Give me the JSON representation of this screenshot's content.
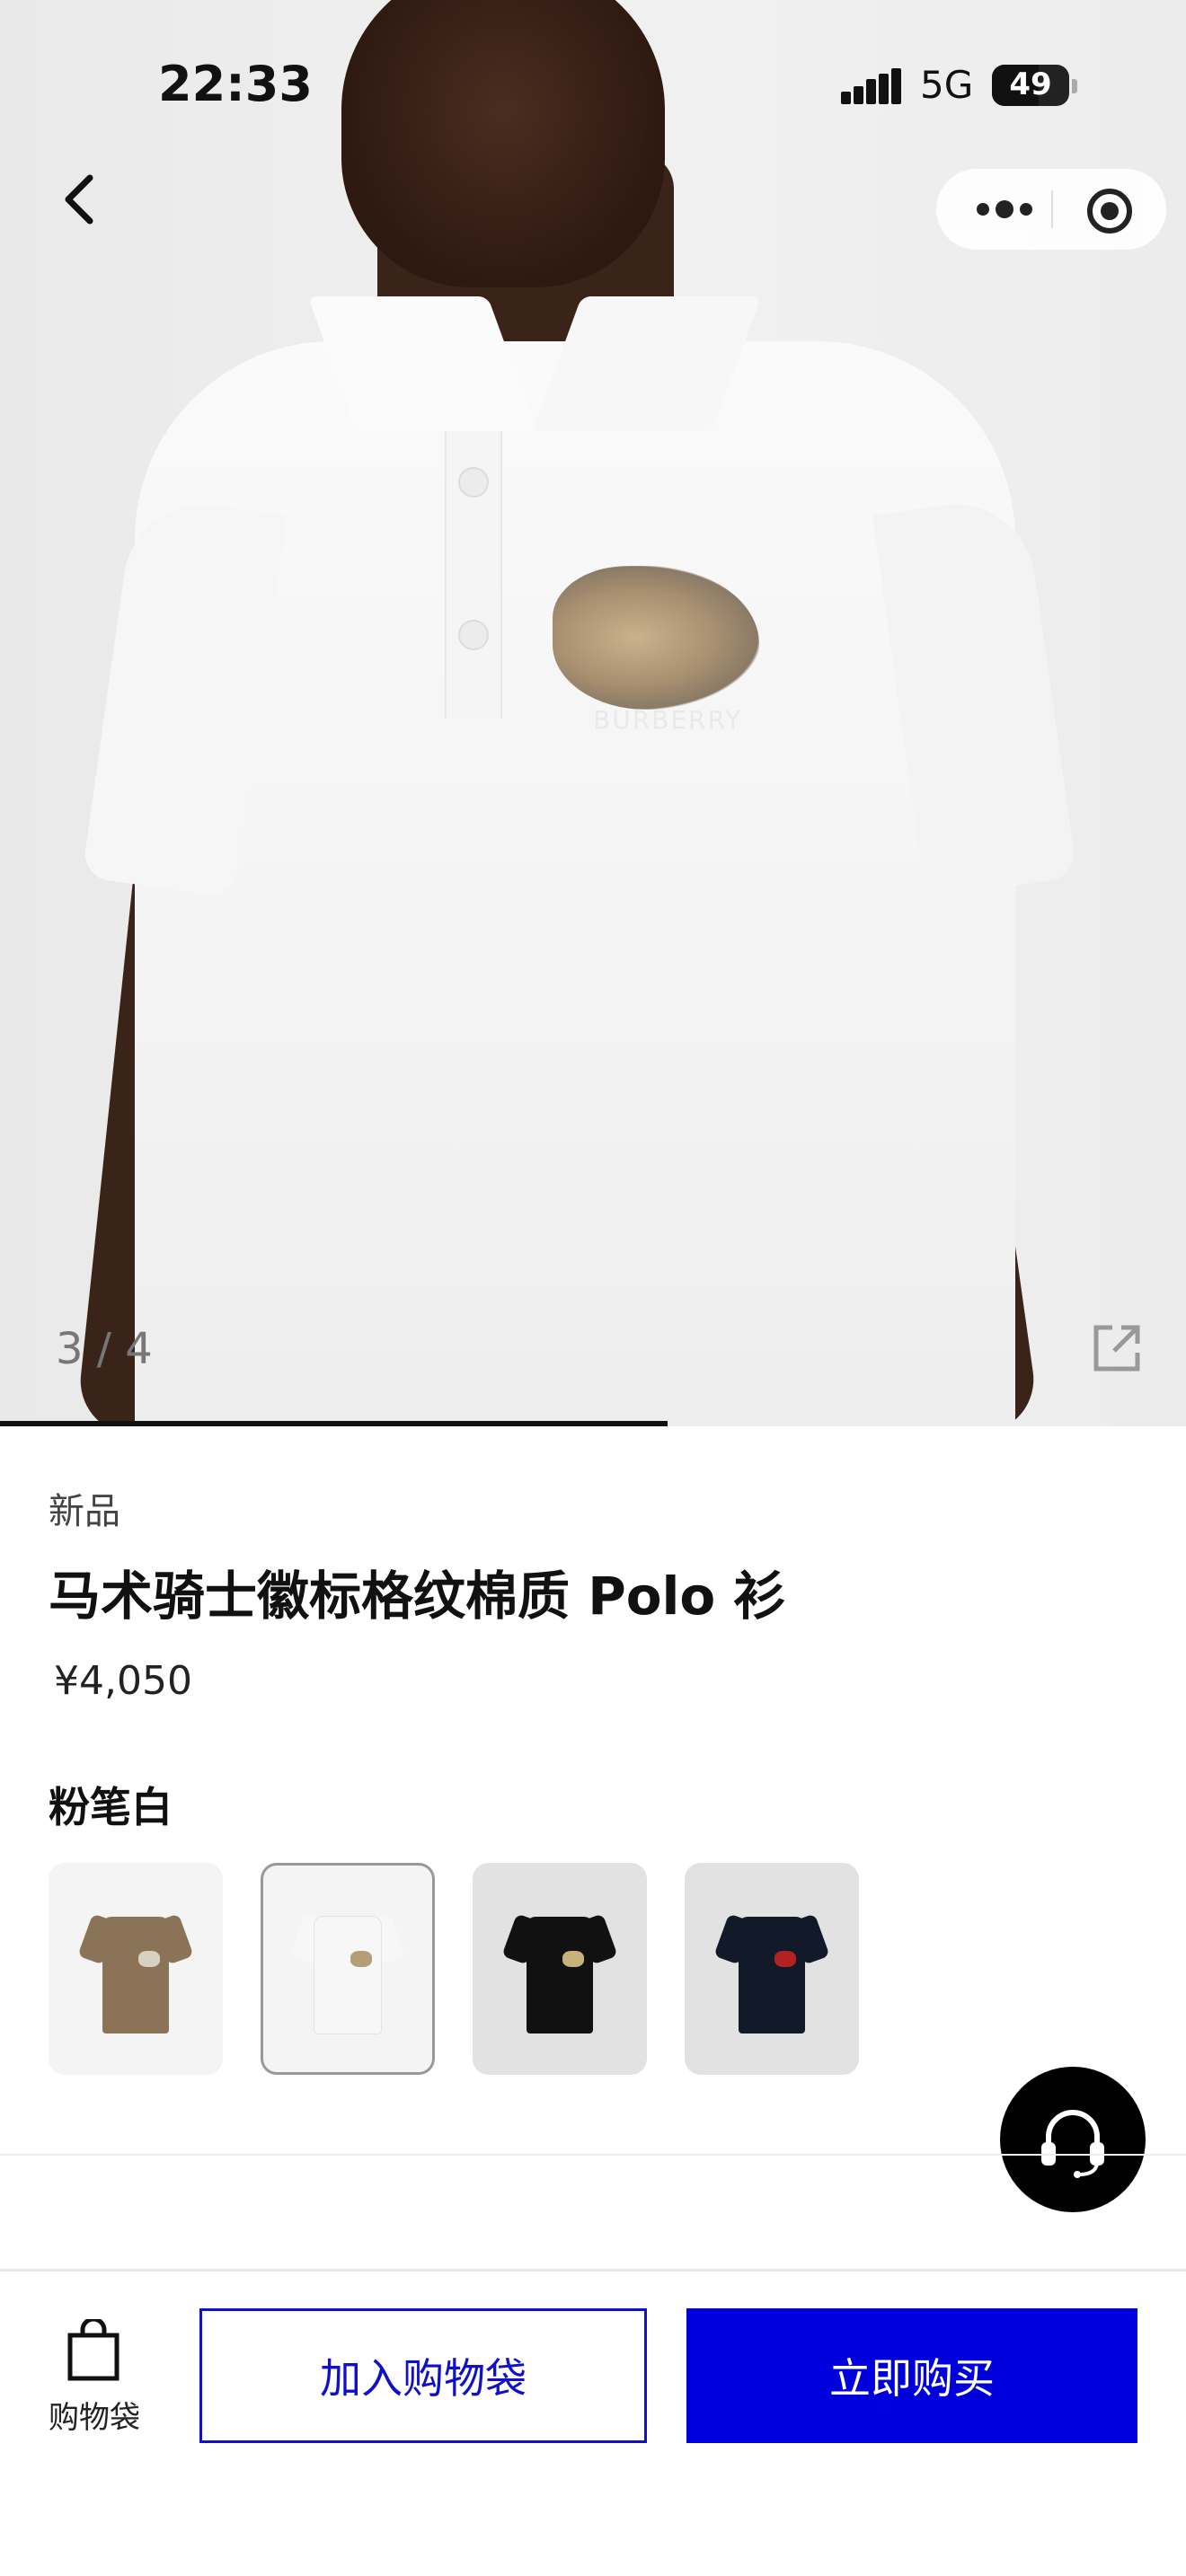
{
  "status_bar": {
    "time": "22:33",
    "network": "5G",
    "battery": "49"
  },
  "gallery": {
    "page_indicator": "3 / 4",
    "progress": 0.75,
    "emblem_text": "BURBERRY"
  },
  "product": {
    "tag": "新品",
    "title": "马术骑士徽标格纹棉质 Polo 衫",
    "price": "¥4,050",
    "color_name": "粉笔白",
    "swatches": [
      {
        "bg": "#f4f4f4",
        "shirt": "#8a7356",
        "badge": "#d8d0c0",
        "selected": false
      },
      {
        "bg": "#f4f4f4",
        "shirt": "#f7f7f7",
        "badge": "#b59d76",
        "selected": true
      },
      {
        "bg": "#e2e2e2",
        "shirt": "#111111",
        "badge": "#c6b27a",
        "selected": false
      },
      {
        "bg": "#e2e2e2",
        "shirt": "#121a2a",
        "badge": "#b22222",
        "selected": false
      }
    ]
  },
  "bottom_bar": {
    "bag_label": "购物袋",
    "add_to_bag": "加入购物袋",
    "buy_now": "立即购买"
  },
  "colors": {
    "accent_blue": "#0000dd",
    "outline_blue": "#1010c8"
  },
  "icons": [
    "back-arrow-icon",
    "more-dots-icon",
    "target-icon",
    "share-icon",
    "headset-icon",
    "shopping-bag-icon"
  ]
}
